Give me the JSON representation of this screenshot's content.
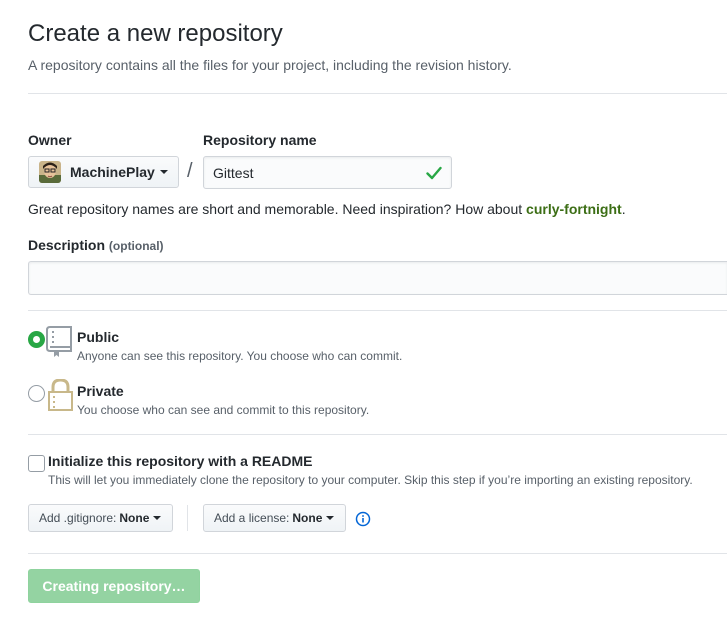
{
  "header": {
    "title": "Create a new repository",
    "subtitle": "A repository contains all the files for your project, including the revision history."
  },
  "owner": {
    "label": "Owner",
    "name": "MachinePlay",
    "avatar_icon": "user-avatar"
  },
  "separator": "/",
  "repo": {
    "label": "Repository name",
    "value": "Gittest",
    "valid_icon": "check-icon",
    "hint_prefix": "Great repository names are short and memorable. Need inspiration? How about ",
    "suggestion": "curly-fortnight",
    "hint_suffix": "."
  },
  "description": {
    "label": "Description",
    "optional": "(optional)",
    "value": ""
  },
  "visibility": {
    "public": {
      "title": "Public",
      "desc": "Anyone can see this repository. You choose who can commit.",
      "icon": "repo-book-icon",
      "checked": true
    },
    "private": {
      "title": "Private",
      "desc": "You choose who can see and commit to this repository.",
      "icon": "lock-icon",
      "checked": false
    }
  },
  "readme": {
    "title": "Initialize this repository with a README",
    "desc": "This will let you immediately clone the repository to your computer. Skip this step if you’re importing an existing repository.",
    "checked": false
  },
  "gitignore": {
    "prefix": "Add .gitignore:",
    "value": "None"
  },
  "license": {
    "prefix": "Add a license:",
    "value": "None"
  },
  "submit": {
    "label": "Creating repository…"
  },
  "colors": {
    "accent_green": "#28a745",
    "suggestion_green": "#3c6e15",
    "info_blue": "#0366d6",
    "disabled_button": "#94d3a2"
  }
}
